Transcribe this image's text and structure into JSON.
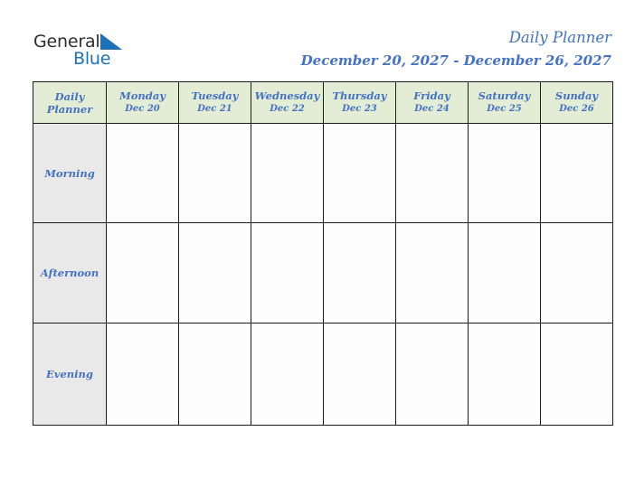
{
  "brand": {
    "word_dark": "General",
    "word_blue": "Blue",
    "mark": "blue-triangle-logo",
    "dark_color": "#2e2e2e",
    "blue_color": "#1d71b8"
  },
  "header": {
    "title": "Daily Planner",
    "subtitle": "December 20, 2027 - December 26, 2027",
    "title_color": "#4472c4"
  },
  "planner": {
    "corner_label_line1": "Daily",
    "corner_label_line2": "Planner",
    "header_bg": "#e3edd5",
    "row_label_bg": "#e9e9e9",
    "cell_bg": "#fdfdfd",
    "border_color": "#1c1c1c",
    "columns": [
      {
        "day": "Monday",
        "date": "Dec 20"
      },
      {
        "day": "Tuesday",
        "date": "Dec 21"
      },
      {
        "day": "Wednesday",
        "date": "Dec 22"
      },
      {
        "day": "Thursday",
        "date": "Dec 23"
      },
      {
        "day": "Friday",
        "date": "Dec 24"
      },
      {
        "day": "Saturday",
        "date": "Dec 25"
      },
      {
        "day": "Sunday",
        "date": "Dec 26"
      }
    ],
    "rows": [
      {
        "label": "Morning",
        "entries": [
          "",
          "",
          "",
          "",
          "",
          "",
          ""
        ]
      },
      {
        "label": "Afternoon",
        "entries": [
          "",
          "",
          "",
          "",
          "",
          "",
          ""
        ]
      },
      {
        "label": "Evening",
        "entries": [
          "",
          "",
          "",
          "",
          "",
          "",
          ""
        ]
      }
    ]
  }
}
